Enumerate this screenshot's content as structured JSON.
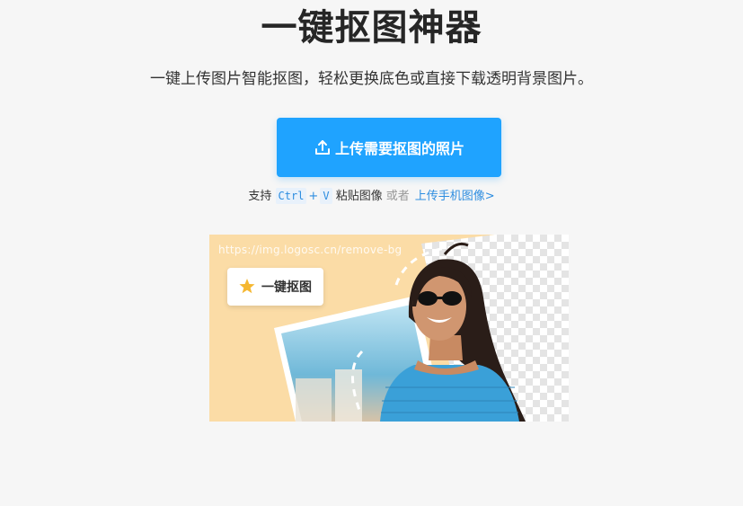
{
  "header": {
    "title": "一键抠图神器",
    "subtitle": "一键上传图片智能抠图，轻松更换底色或直接下载透明背景图片。"
  },
  "upload": {
    "button_label": "上传需要抠图的照片",
    "icon": "upload-icon"
  },
  "hint": {
    "prefix": "支持",
    "key1": "Ctrl",
    "plus": "+",
    "key2": "V",
    "paste_text": "粘贴图像",
    "or_text": "或者",
    "mobile_link": "上传手机图像>"
  },
  "demo": {
    "url_text": "https://img.logosc.cn/remove-bg",
    "badge_label": "一键抠图",
    "badge_icon": "magic-wand-icon"
  },
  "colors": {
    "accent": "#1fa3ff",
    "link": "#2d8de0",
    "background": "#f6f6f6",
    "demo_bg": "#fbdca6"
  }
}
